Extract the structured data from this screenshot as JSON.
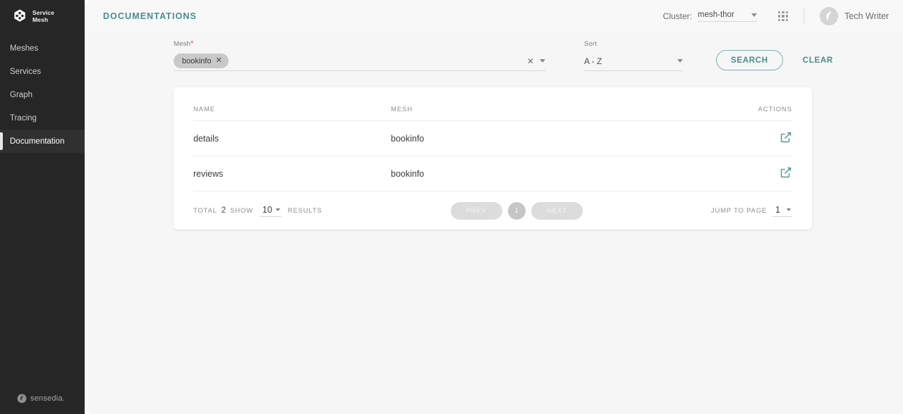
{
  "sidebar": {
    "brand": {
      "line1": "Service",
      "line2": "Mesh",
      "logo_icon": "service-mesh-logo-icon"
    },
    "items": [
      {
        "label": "Meshes",
        "active": false
      },
      {
        "label": "Services",
        "active": false
      },
      {
        "label": "Graph",
        "active": false
      },
      {
        "label": "Tracing",
        "active": false
      },
      {
        "label": "Documentation",
        "active": true
      }
    ],
    "footer": {
      "label": "sensedia.",
      "logo_icon": "sensedia-logo-icon"
    }
  },
  "topbar": {
    "page_title": "DOCUMENTATIONS",
    "cluster_label": "Cluster:",
    "cluster_value": "mesh-thor",
    "apps_icon": "apps-grid-icon",
    "user_name": "Tech Writer",
    "avatar_icon": "user-avatar-icon"
  },
  "filters": {
    "mesh": {
      "label": "Mesh",
      "required_marker": "*",
      "chips": [
        {
          "label": "bookinfo",
          "remove_icon": "close-icon"
        }
      ],
      "clear_icon": "clear-icon",
      "dropdown_icon": "chevron-down-icon"
    },
    "sort": {
      "label": "Sort",
      "value": "A - Z",
      "dropdown_icon": "chevron-down-icon"
    },
    "search_button": "SEARCH",
    "clear_button": "CLEAR"
  },
  "table": {
    "columns": [
      "NAME",
      "MESH",
      "ACTIONS"
    ],
    "rows": [
      {
        "name": "details",
        "mesh": "bookinfo",
        "action_icon": "external-link-icon"
      },
      {
        "name": "reviews",
        "mesh": "bookinfo",
        "action_icon": "external-link-icon"
      }
    ]
  },
  "pagination": {
    "total_label": "TOTAL",
    "total_value": "2",
    "show_label": "SHOW",
    "show_value": "10",
    "results_label": "RESULTS",
    "prev_label": "PREV",
    "current_page": "1",
    "next_label": "NEXT",
    "jump_label": "JUMP TO PAGE",
    "jump_value": "1"
  },
  "colors": {
    "accent_teal": "#4b8c8c",
    "sidebar_bg": "#262626",
    "page_bg": "#f6f6f6",
    "card_bg": "#ffffff",
    "required_red": "#e05c5c"
  }
}
